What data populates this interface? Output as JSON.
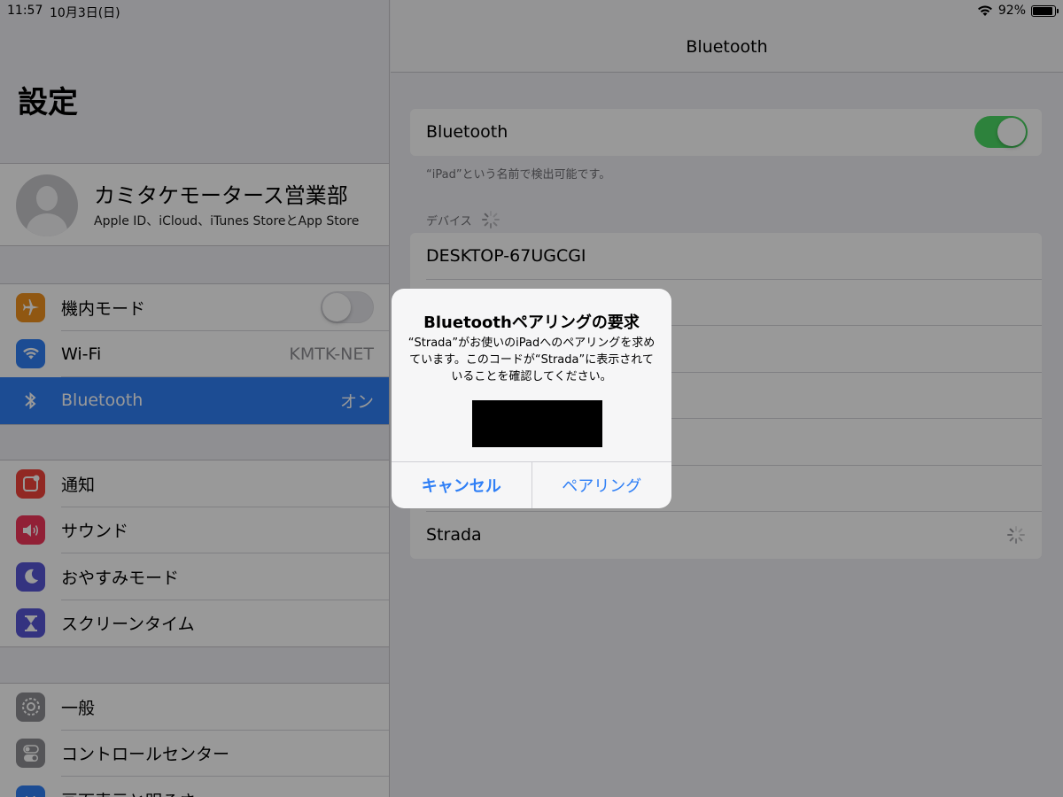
{
  "status_bar": {
    "time": "11:57",
    "date": "10月3日(日)",
    "battery": "92%",
    "battery_fraction": 0.92
  },
  "sidebar": {
    "title": "設定",
    "profile": {
      "name": "カミタケモータース営業部",
      "subtitle": "Apple ID、iCloud、iTunes StoreとApp Store"
    },
    "group1": [
      {
        "label": "機内モード",
        "icon": "airplane-icon",
        "color": "#f0921e",
        "toggle": false
      },
      {
        "label": "Wi-Fi",
        "icon": "wifi-icon",
        "color": "#2f7ff6",
        "value": "KMTK-NET"
      },
      {
        "label": "Bluetooth",
        "icon": "bluetooth-icon",
        "color": "#2f7ff6",
        "value": "オン",
        "selected": true
      }
    ],
    "group2": [
      {
        "label": "通知",
        "icon": "notifications-icon",
        "color": "#f2443b"
      },
      {
        "label": "サウンド",
        "icon": "sound-icon",
        "color": "#f2365a"
      },
      {
        "label": "おやすみモード",
        "icon": "moon-icon",
        "color": "#5856d6"
      },
      {
        "label": "スクリーンタイム",
        "icon": "hourglass-icon",
        "color": "#5856d6"
      }
    ],
    "group3": [
      {
        "label": "一般",
        "icon": "gear-icon",
        "color": "#8e8e93"
      },
      {
        "label": "コントロールセンター",
        "icon": "toggles-icon",
        "color": "#8e8e93"
      },
      {
        "label": "画面表示と明るさ",
        "icon": "display-icon",
        "color": "#2f7ff6"
      }
    ]
  },
  "detail": {
    "title": "Bluetooth",
    "bluetooth_label": "Bluetooth",
    "bluetooth_on": true,
    "discoverable_note": "“iPad”という名前で検出可能です。",
    "devices_header": "デバイス",
    "devices": [
      "DESKTOP-67UGCGI",
      "",
      "",
      "",
      "",
      "",
      "Strada"
    ]
  },
  "alert": {
    "title": "Bluetoothペアリングの要求",
    "message": "“Strada”がお使いのiPadへのペアリングを求めています。このコードが“Strada”に表示されていることを確認してください。",
    "cancel_label": "キャンセル",
    "pair_label": "ペアリング"
  },
  "colors": {
    "accent": "#2f7ff6",
    "switch_on": "#4cd964",
    "dim_overlay": "rgba(0,0,0,0.4)"
  }
}
